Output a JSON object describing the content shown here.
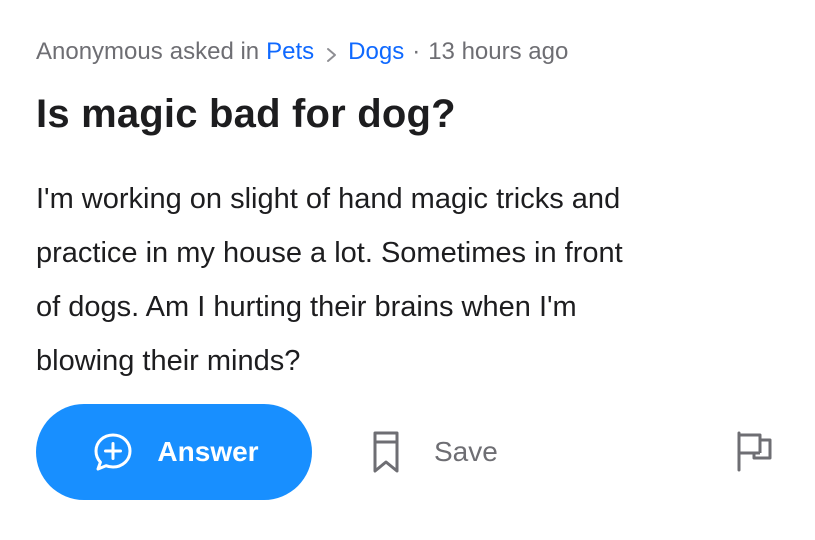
{
  "meta": {
    "author": "Anonymous",
    "asked_in": "asked in",
    "category": "Pets",
    "subcategory": "Dogs",
    "separator_dot": "·",
    "time_ago": "13 hours ago"
  },
  "question": {
    "title": "Is magic bad for dog?",
    "body_lines": [
      "I'm working on slight of hand magic tricks and",
      "practice in my house a lot. Sometimes in front",
      "of dogs. Am I hurting their brains when I'm",
      "blowing their minds?"
    ]
  },
  "actions": {
    "answer_label": "Answer",
    "save_label": "Save",
    "answer_icon": "plus-speech-bubble-icon",
    "save_icon": "bookmark-icon",
    "flag_icon": "flag-icon"
  },
  "colors": {
    "accent": "#188fff",
    "link": "#0f69ff",
    "muted": "#6e6e73",
    "text": "#1d1d1f",
    "background": "#ffffff"
  }
}
